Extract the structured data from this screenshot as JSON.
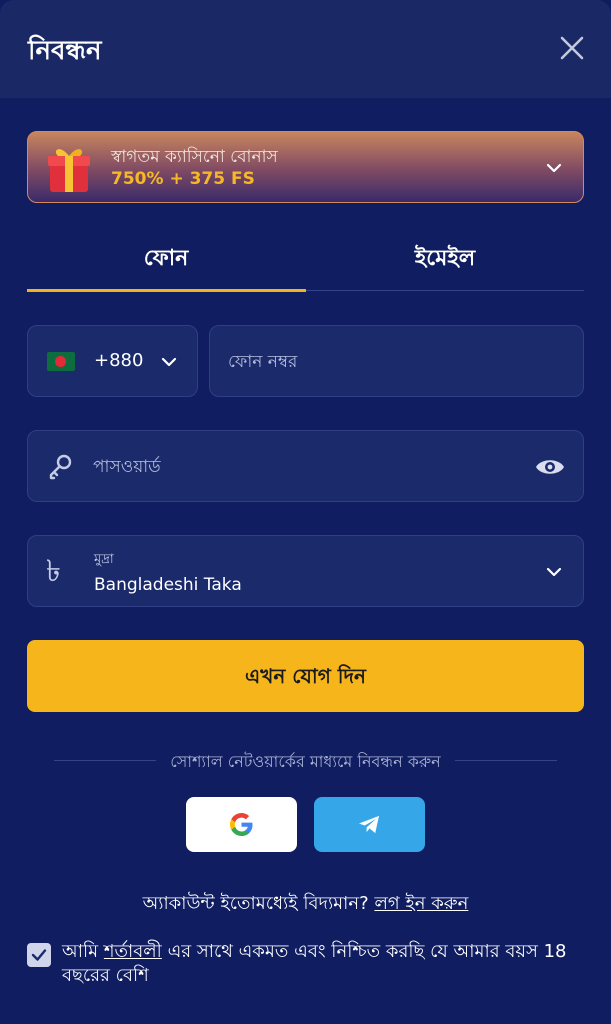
{
  "header": {
    "title": "নিবন্ধন",
    "close_icon": "close-icon"
  },
  "bonus": {
    "title": "স্বাগতম ক্যাসিনো বোনাস",
    "amount": "750% + 375 FS",
    "gift_icon": "gift-icon",
    "accent": "#f7b827"
  },
  "tabs": [
    {
      "label": "ফোন",
      "active": true
    },
    {
      "label": "ইমেইল",
      "active": false
    }
  ],
  "phone": {
    "country_code": "+880",
    "flag": "bangladesh-flag",
    "placeholder": "ফোন নম্বর",
    "value": ""
  },
  "password": {
    "placeholder": "পাসওয়ার্ড",
    "value": ""
  },
  "currency": {
    "label": "মুদ্রা",
    "value": "Bangladeshi Taka",
    "symbol": "৳"
  },
  "submit": {
    "label": "এখন যোগ দিন",
    "color": "#f7b51c"
  },
  "social": {
    "divider_text": "সোশ্যাল নেটওয়ার্কের মাধ্যমে নিবন্ধন করুন",
    "providers": [
      "google",
      "telegram"
    ]
  },
  "login": {
    "prompt": "অ্যাকাউন্ট ইতোমধ্যেই বিদ্যমান?",
    "link": "লগ ইন করুন"
  },
  "terms": {
    "prefix": "আমি",
    "link": "শর্তাবলী",
    "suffix": "এর সাথে একমত এবং নিশ্চিত করছি যে আমার বয়স 18 বছরের বেশি",
    "checked": true
  },
  "colors": {
    "background": "#101d60",
    "header": "#1a2866",
    "field": "#1b2a6b",
    "accent": "#f5b21a"
  }
}
